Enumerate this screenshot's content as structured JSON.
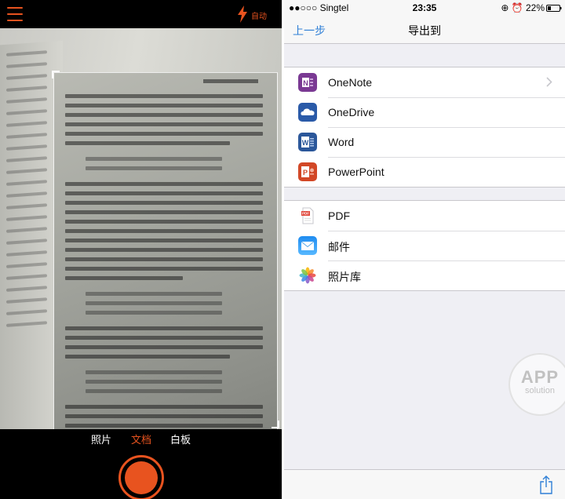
{
  "camera": {
    "flash_label": "自动",
    "modes": [
      "照片",
      "文档",
      "白板"
    ],
    "active_mode": "文档",
    "accent_color": "#e8531f"
  },
  "status_bar": {
    "carrier": "●●○○○ Singtel",
    "time": "23:35",
    "right": "⊕ ⏰ 22%"
  },
  "nav": {
    "back_label": "上一步",
    "title": "导出到"
  },
  "export_groups": [
    {
      "items": [
        {
          "label": "OneNote",
          "icon": "onenote-icon",
          "has_chevron": true
        },
        {
          "label": "OneDrive",
          "icon": "onedrive-icon"
        },
        {
          "label": "Word",
          "icon": "word-icon"
        },
        {
          "label": "PowerPoint",
          "icon": "powerpoint-icon"
        }
      ]
    },
    {
      "items": [
        {
          "label": "PDF",
          "icon": "pdf-icon"
        },
        {
          "label": "邮件",
          "icon": "mail-icon"
        },
        {
          "label": "照片库",
          "icon": "photos-icon"
        }
      ]
    }
  ],
  "watermark": {
    "title": "APP",
    "subtitle": "solution"
  },
  "colors": {
    "ios_blue": "#2f7fd6",
    "onenote": "#7a3993",
    "onedrive": "#2a5aa8",
    "word": "#2b579a",
    "powerpoint": "#d24726"
  }
}
